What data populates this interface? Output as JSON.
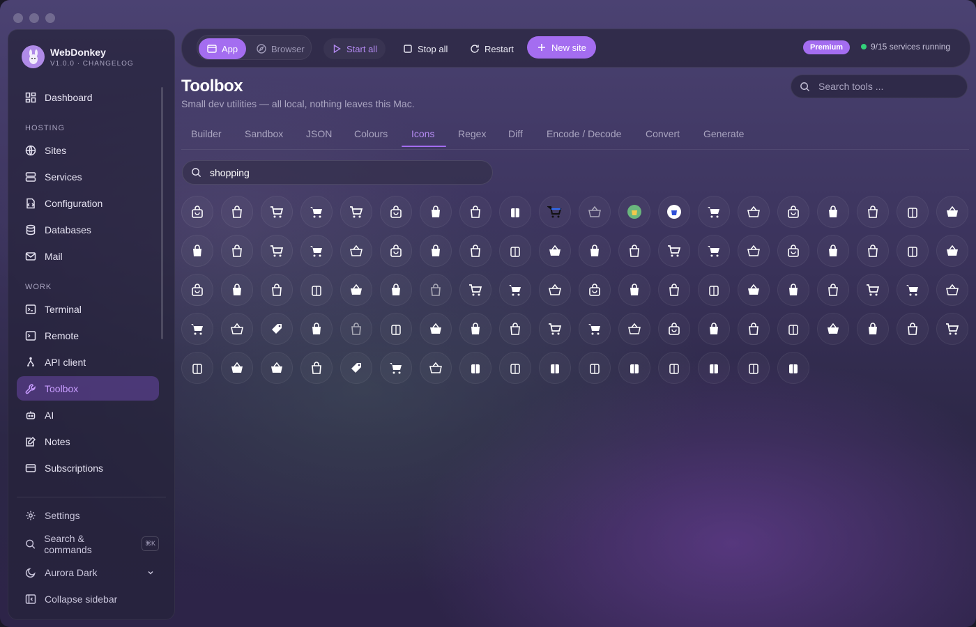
{
  "app": {
    "name": "WebDonkey",
    "version": "V1.0.0 · CHANGELOG"
  },
  "sidebar": {
    "dashboard": "Dashboard",
    "sections": {
      "hosting": "HOSTING",
      "work": "WORK"
    },
    "items": [
      {
        "label": "Sites",
        "icon": "globe-icon"
      },
      {
        "label": "Services",
        "icon": "server-icon"
      },
      {
        "label": "Configuration",
        "icon": "config-icon"
      },
      {
        "label": "Databases",
        "icon": "database-icon"
      },
      {
        "label": "Mail",
        "icon": "mail-icon"
      },
      {
        "label": "Terminal",
        "icon": "terminal-icon"
      },
      {
        "label": "Remote",
        "icon": "remote-icon"
      },
      {
        "label": "API client",
        "icon": "api-icon"
      },
      {
        "label": "Toolbox",
        "icon": "wrench-icon",
        "active": true
      },
      {
        "label": "AI",
        "icon": "robot-icon"
      },
      {
        "label": "Notes",
        "icon": "notes-icon"
      },
      {
        "label": "Subscriptions",
        "icon": "card-icon"
      }
    ],
    "footer": {
      "settings": "Settings",
      "search": "Search & commands",
      "shortcut": "⌘K",
      "theme": "Aurora Dark",
      "collapse": "Collapse sidebar"
    }
  },
  "topbar": {
    "app": "App",
    "browser": "Browser",
    "start_all": "Start all",
    "stop_all": "Stop all",
    "restart": "Restart",
    "new_site": "New site",
    "premium": "Premium",
    "status": "9/15 services running"
  },
  "main": {
    "title": "Toolbox",
    "subtitle": "Small dev utilities — all local, nothing leaves this Mac.",
    "search_placeholder": "Search tools ...",
    "tabs": [
      "Builder",
      "Sandbox",
      "JSON",
      "Colours",
      "Icons",
      "Regex",
      "Diff",
      "Encode / Decode",
      "Convert",
      "Generate"
    ],
    "active_tab": "Icons",
    "icon_search_value": "shopping"
  },
  "colors": {
    "accent": "#a46df0",
    "status_green": "#33d17a"
  }
}
